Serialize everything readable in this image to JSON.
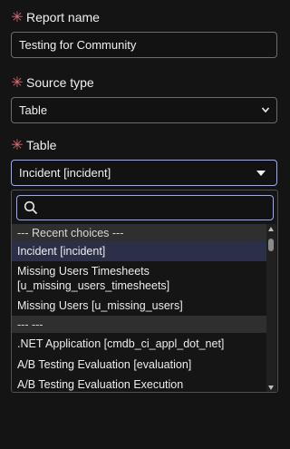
{
  "form": {
    "report_name": {
      "label": "Report name",
      "value": "Testing for Community"
    },
    "source_type": {
      "label": "Source type",
      "value": "Table"
    },
    "table": {
      "label": "Table",
      "value": "Incident [incident]"
    },
    "required_mark": "✳"
  },
  "dropdown": {
    "search_placeholder": "",
    "options": [
      {
        "text": "--- Recent choices ---",
        "kind": "group"
      },
      {
        "text": "Incident [incident]",
        "kind": "highlighted"
      },
      {
        "text": "Missing Users Timesheets [u_missing_users_timesheets]",
        "kind": "option"
      },
      {
        "text": "Missing Users [u_missing_users]",
        "kind": "option"
      },
      {
        "text": "--- ---",
        "kind": "group"
      },
      {
        "text": ".NET Application [cmdb_ci_appl_dot_net]",
        "kind": "option"
      },
      {
        "text": "A/B Testing Evaluation [evaluation]",
        "kind": "option"
      },
      {
        "text": "A/B Testing Evaluation Execution",
        "kind": "option"
      }
    ]
  },
  "colors": {
    "accent": "#9ca8ff",
    "required": "#e06a73",
    "highlight": "#2c2f48",
    "group_bg": "#2f2f2f"
  }
}
